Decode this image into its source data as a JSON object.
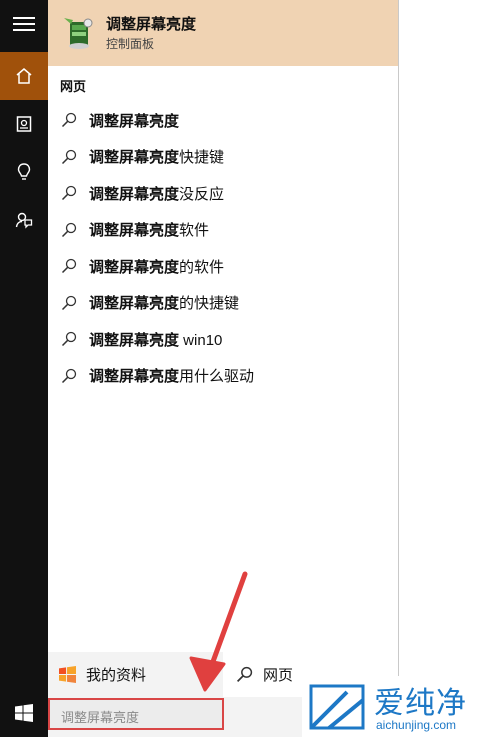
{
  "best_match": {
    "title": "调整屏幕亮度",
    "subtitle": "控制面板",
    "icon": "control-panel-icon"
  },
  "section": {
    "heading": "网页"
  },
  "results": [
    {
      "bold": "调整屏幕亮度",
      "rest": ""
    },
    {
      "bold": "调整屏幕亮度",
      "rest": "快捷键"
    },
    {
      "bold": "调整屏幕亮度",
      "rest": "没反应"
    },
    {
      "bold": "调整屏幕亮度",
      "rest": "软件"
    },
    {
      "bold": "调整屏幕亮度",
      "rest": "的软件"
    },
    {
      "bold": "调整屏幕亮度",
      "rest": "的快捷键"
    },
    {
      "bold": "调整屏幕亮度",
      "rest": " win10"
    },
    {
      "bold": "调整屏幕亮度",
      "rest": "用什么驱动"
    }
  ],
  "footer": {
    "my_data_label": "我的资料",
    "web_label": "网页"
  },
  "search": {
    "value": "调整屏幕亮度"
  },
  "watermark": {
    "brand": "爱纯净",
    "url": "aichunjing.com"
  },
  "colors": {
    "accent": "#a0510b",
    "best_match_bg": "#f0d3b3",
    "annotation": "#e0403f",
    "watermark": "#1d78c6"
  }
}
